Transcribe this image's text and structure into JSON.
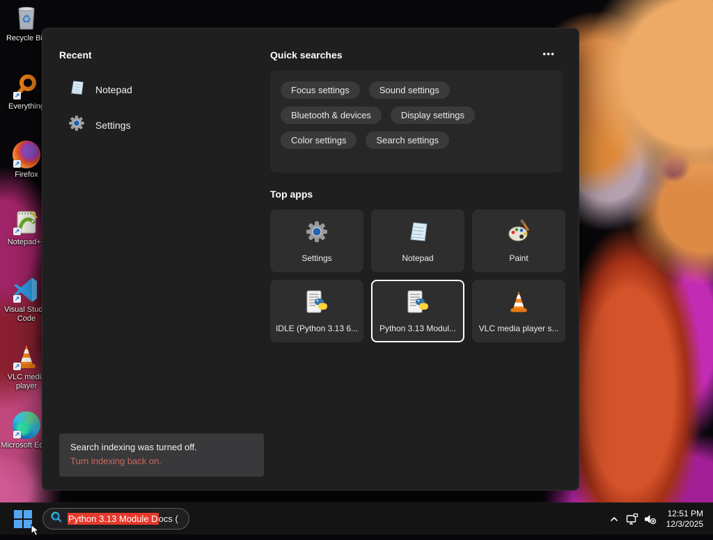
{
  "desktop": {
    "icons": [
      {
        "label": "Recycle Bin"
      },
      {
        "label": "Everything"
      },
      {
        "label": "Firefox"
      },
      {
        "label": "Notepad++"
      },
      {
        "label": "Visual Studio Code"
      },
      {
        "label": "VLC media player"
      },
      {
        "label": "Microsoft Edge"
      }
    ]
  },
  "search_panel": {
    "recent": {
      "header": "Recent",
      "items": [
        {
          "label": "Notepad",
          "icon": "notepad-icon"
        },
        {
          "label": "Settings",
          "icon": "settings-gear-icon"
        }
      ]
    },
    "quick_searches": {
      "header": "Quick searches",
      "more_label": "•••",
      "pills": [
        "Focus settings",
        "Sound settings",
        "Bluetooth & devices",
        "Display settings",
        "Color settings",
        "Search settings"
      ]
    },
    "top_apps": {
      "header": "Top apps",
      "tiles": [
        {
          "label": "Settings",
          "icon": "settings-gear-icon",
          "selected": false
        },
        {
          "label": "Notepad",
          "icon": "notepad-icon",
          "selected": false
        },
        {
          "label": "Paint",
          "icon": "paint-palette-icon",
          "selected": false
        },
        {
          "label": "IDLE (Python 3.13 6...",
          "icon": "python-doc-icon",
          "selected": false
        },
        {
          "label": "Python 3.13 Modul...",
          "icon": "python-doc-icon",
          "selected": true
        },
        {
          "label": "VLC media player s...",
          "icon": "vlc-cone-icon",
          "selected": false
        }
      ]
    },
    "indexing_notice": {
      "message": "Search indexing was turned off.",
      "link": "Turn indexing back on."
    }
  },
  "taskbar": {
    "search_box": {
      "highlighted_text": "Python 3.13 Module D",
      "normal_text": "ocs ("
    },
    "tray": {
      "time": "12:51 PM",
      "date": "12/3/2025"
    }
  },
  "colors": {
    "selection_red": "#e5392b",
    "notice_link_red": "#cd675d",
    "start_blue": "#55a7f3",
    "panel_bg": "#1f1f20"
  }
}
